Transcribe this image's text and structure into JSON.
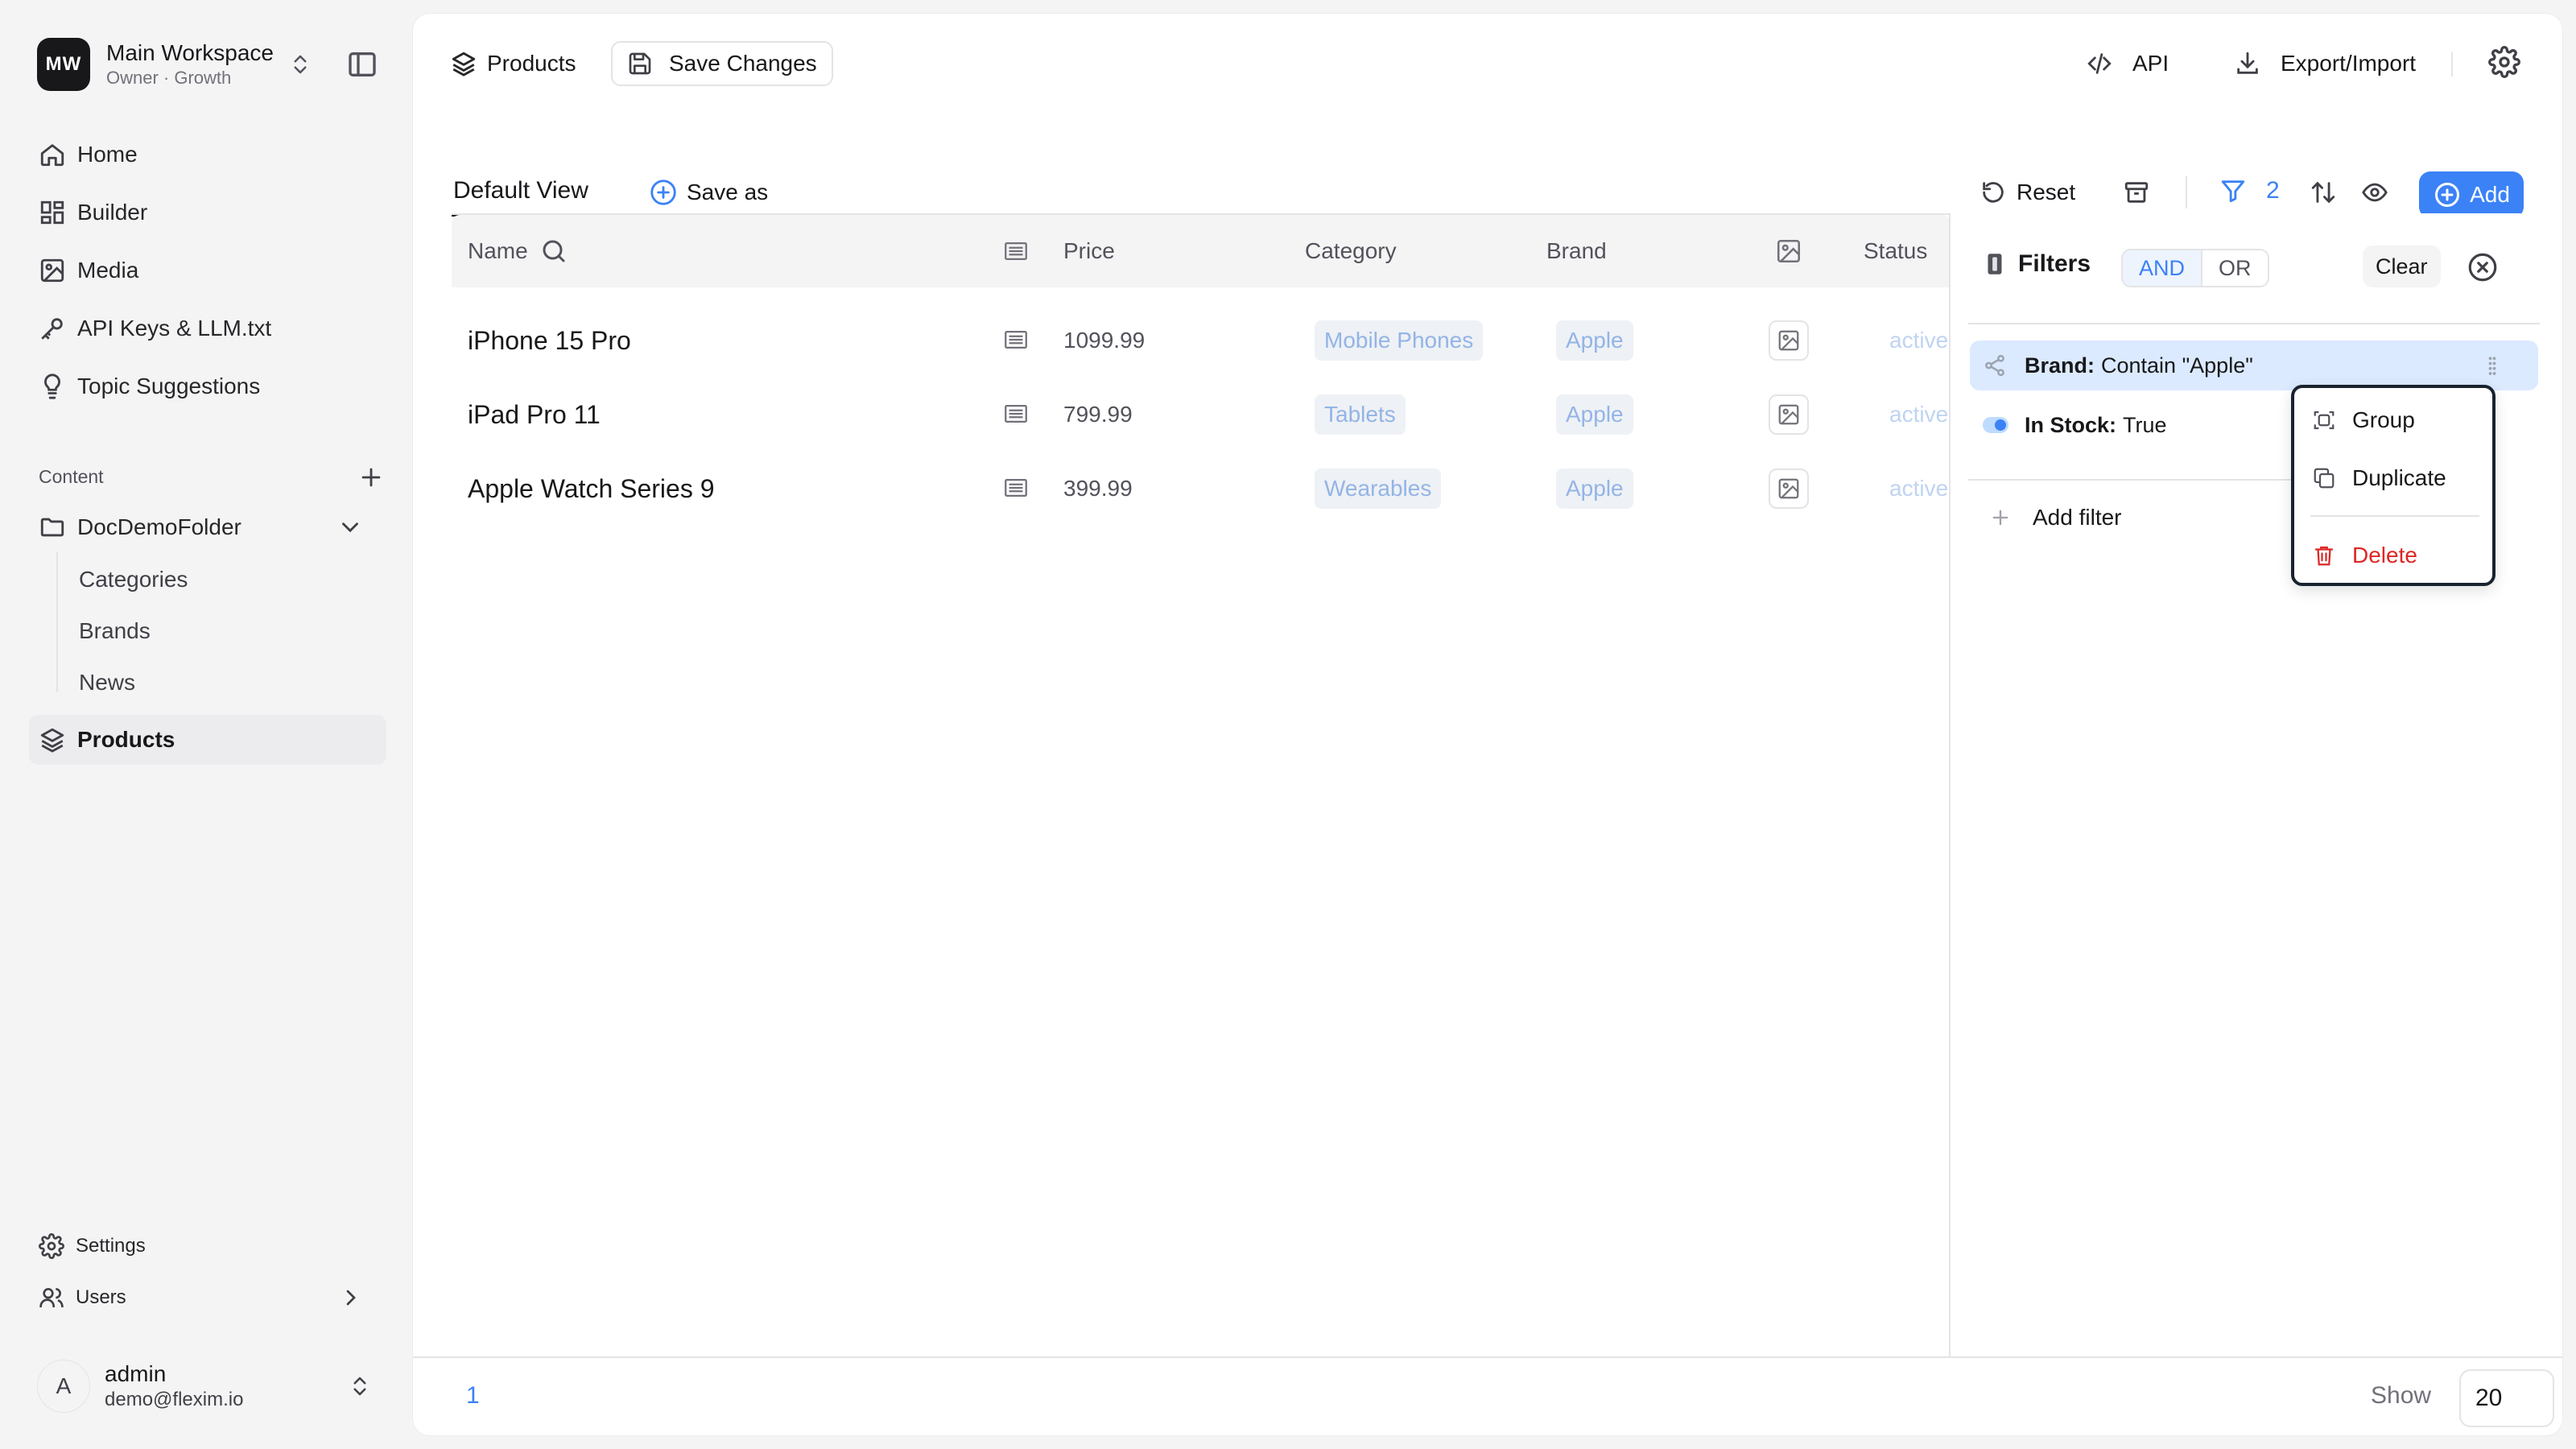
{
  "workspace": {
    "initials": "MW",
    "name": "Main Workspace",
    "subtitle": "Owner · Growth"
  },
  "nav": [
    {
      "label": "Home",
      "icon": "home-icon"
    },
    {
      "label": "Builder",
      "icon": "grid-icon"
    },
    {
      "label": "Media",
      "icon": "image-icon"
    },
    {
      "label": "API Keys & LLM.txt",
      "icon": "key-icon"
    },
    {
      "label": "Topic Suggestions",
      "icon": "lightbulb-icon"
    }
  ],
  "content": {
    "heading": "Content",
    "folder": "DocDemoFolder",
    "sub_items": [
      "Categories",
      "Brands",
      "News"
    ],
    "active_item": "Products"
  },
  "bottom_nav": {
    "settings": "Settings",
    "users": "Users"
  },
  "user": {
    "initial": "A",
    "name": "admin",
    "email": "demo@flexim.io"
  },
  "topbar": {
    "crumb": "Products",
    "save_label": "Save Changes",
    "api_label": "API",
    "export_label": "Export/Import"
  },
  "viewbar": {
    "view_tab": "Default View",
    "save_as": "Save as",
    "reset": "Reset",
    "filter_count": "2",
    "add": "Add"
  },
  "table": {
    "columns": {
      "name": "Name",
      "price": "Price",
      "category": "Category",
      "brand": "Brand",
      "status": "Status"
    },
    "rows": [
      {
        "name": "iPhone 15 Pro",
        "price": "1099.99",
        "category": "Mobile Phones",
        "brand": "Apple",
        "status": "active"
      },
      {
        "name": "iPad Pro 11",
        "price": "799.99",
        "category": "Tablets",
        "brand": "Apple",
        "status": "active"
      },
      {
        "name": "Apple Watch Series 9",
        "price": "399.99",
        "category": "Wearables",
        "brand": "Apple",
        "status": "active"
      }
    ]
  },
  "filters": {
    "title": "Filters",
    "logic_and": "AND",
    "logic_or": "OR",
    "clear": "Clear",
    "items": [
      {
        "key": "Brand:",
        "value": "Contain \"Apple\""
      },
      {
        "key": "In Stock:",
        "value": "True"
      }
    ],
    "add_filter": "Add filter"
  },
  "context_menu": {
    "group": "Group",
    "duplicate": "Duplicate",
    "delete": "Delete"
  },
  "footer": {
    "page": "1",
    "show_label": "Show",
    "page_size": "20"
  },
  "colors": {
    "accent": "#3b82f6",
    "danger": "#dc2626",
    "selected_row": "#dbeafe"
  }
}
